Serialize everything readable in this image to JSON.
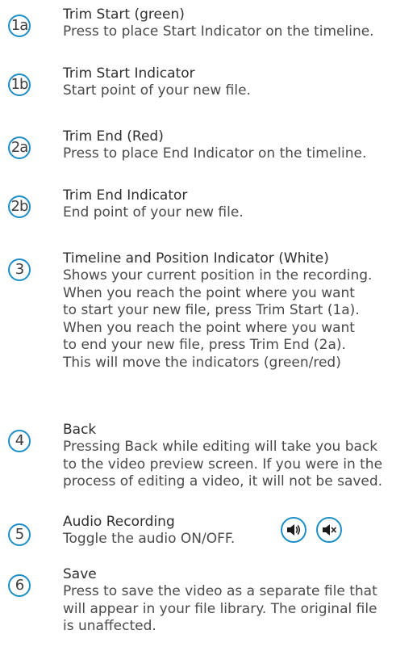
{
  "items": [
    {
      "badge": "1a",
      "title": "Trim Start (green)",
      "lines": [
        "Press to place Start Indicator on the timeline."
      ]
    },
    {
      "badge": "1b",
      "title": "Trim Start Indicator",
      "lines": [
        "Start point of your new file."
      ]
    },
    {
      "badge": "2a",
      "title": "Trim End (Red)",
      "lines": [
        "Press to place End Indicator on the timeline."
      ]
    },
    {
      "badge": "2b",
      "title": "Trim End Indicator",
      "lines": [
        "End point of your new file."
      ]
    },
    {
      "badge": "3",
      "title": "Timeline and Position Indicator (White)",
      "lines": [
        "Shows your current position in the recording.",
        "When you reach the point where you want",
        "to start your new file, press Trim Start (1a).",
        "When you reach the point where you want",
        "to end your new file, press Trim End (2a).",
        "This will move the indicators (green/red)"
      ]
    },
    {
      "badge": "4",
      "title": "Back",
      "lines": [
        "Pressing Back while editing will take you back",
        "to the video preview screen. If you were in the",
        "process of editing a video, it will not be saved."
      ]
    },
    {
      "badge": "5",
      "title": "Audio Recording",
      "lines": [
        "Toggle the audio ON/OFF."
      ]
    },
    {
      "badge": "6",
      "title": "Save",
      "lines": [
        "Press to save the video as a separate file that",
        "will appear in your file library. The original file",
        "is unaffected."
      ]
    }
  ],
  "icons": {
    "audio_on": "speaker-on-icon",
    "audio_off": "speaker-muted-icon"
  },
  "colors": {
    "badge_border": "#1e8fc6",
    "text": "#4a4a4a"
  }
}
